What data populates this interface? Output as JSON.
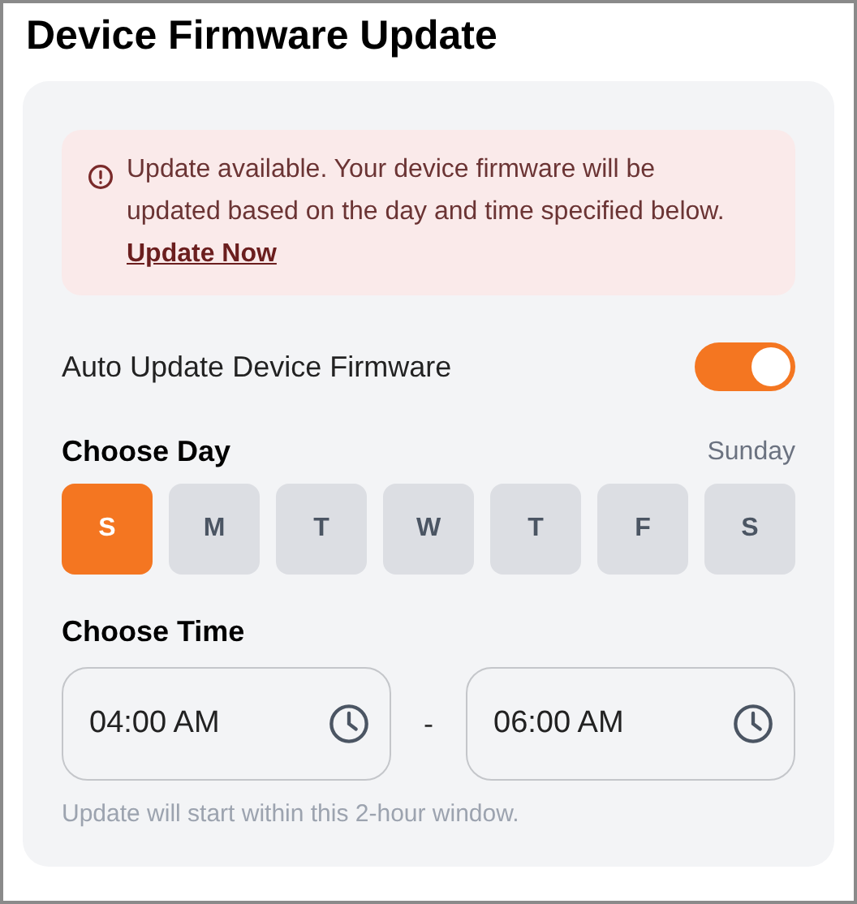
{
  "title": "Device Firmware Update",
  "alert": {
    "text": "Update available. Your device firmware will be updated based on the day and time specified below.",
    "link": "Update Now"
  },
  "auto_update": {
    "label": "Auto Update Device Firmware",
    "on": true
  },
  "day": {
    "heading": "Choose Day",
    "selected_name": "Sunday",
    "days": [
      {
        "label": "S",
        "selected": true
      },
      {
        "label": "M",
        "selected": false
      },
      {
        "label": "T",
        "selected": false
      },
      {
        "label": "W",
        "selected": false
      },
      {
        "label": "T",
        "selected": false
      },
      {
        "label": "F",
        "selected": false
      },
      {
        "label": "S",
        "selected": false
      }
    ]
  },
  "time": {
    "heading": "Choose Time",
    "start": "04:00 AM",
    "separator": "-",
    "end": "06:00 AM",
    "hint": "Update will start within this 2-hour window."
  }
}
